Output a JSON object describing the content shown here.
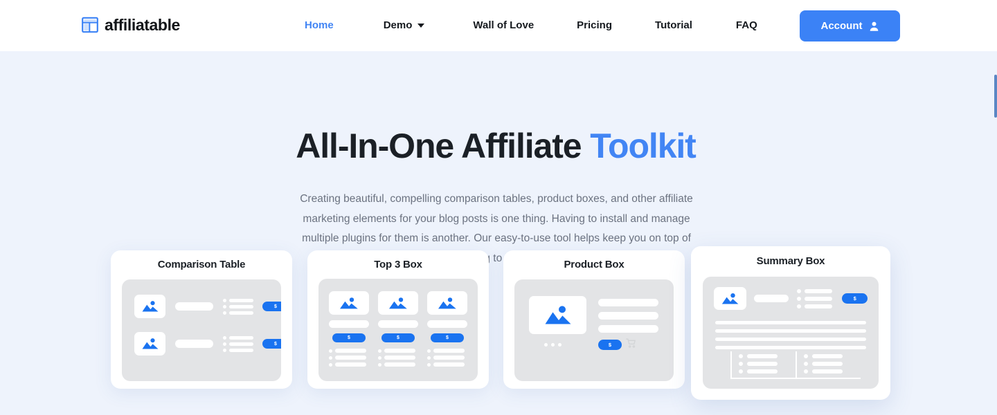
{
  "brand": {
    "name": "affiliatable",
    "icon": "table-logo-icon"
  },
  "nav": {
    "items": [
      {
        "label": "Home",
        "active": true,
        "dropdown": false
      },
      {
        "label": "Demo",
        "active": false,
        "dropdown": true
      },
      {
        "label": "Wall of Love",
        "active": false,
        "dropdown": false
      },
      {
        "label": "Pricing",
        "active": false,
        "dropdown": false
      },
      {
        "label": "Tutorial",
        "active": false,
        "dropdown": false
      },
      {
        "label": "FAQ",
        "active": false,
        "dropdown": false
      }
    ]
  },
  "account_button": {
    "label": "Account",
    "icon": "user-icon",
    "color": "#3b82f6"
  },
  "hero": {
    "title_main": "All-In-One Affiliate ",
    "title_accent": "Toolkit",
    "accent_color": "#4285f4",
    "subtitle": "Creating beautiful, compelling comparison tables, product boxes, and other affiliate marketing elements for your blog posts is one thing. Having to install and manage multiple plugins for them is another. Our easy-to-use tool helps keep you on top of everything without needing to be everywhere all at once.",
    "background_color": "#eef3fc"
  },
  "cards": [
    {
      "id": "comparison",
      "title": "Comparison Table",
      "price_label": "$",
      "rows": 2,
      "bullets_per_row": 3
    },
    {
      "id": "top3",
      "title": "Top 3 Box",
      "price_label": "$",
      "columns": 3,
      "bullets_per_column": 3
    },
    {
      "id": "product",
      "title": "Product Box",
      "price_label": "$",
      "text_lines": 3,
      "cart_icon": "shopping-cart-icon",
      "dots": 3
    },
    {
      "id": "summary",
      "title": "Summary Box",
      "price_label": "$",
      "text_lines": 4,
      "bullet_groups": 2,
      "bullets_per_group": 3,
      "elevated": true
    }
  ],
  "scrollbar": {
    "color": "#5b87c4"
  }
}
